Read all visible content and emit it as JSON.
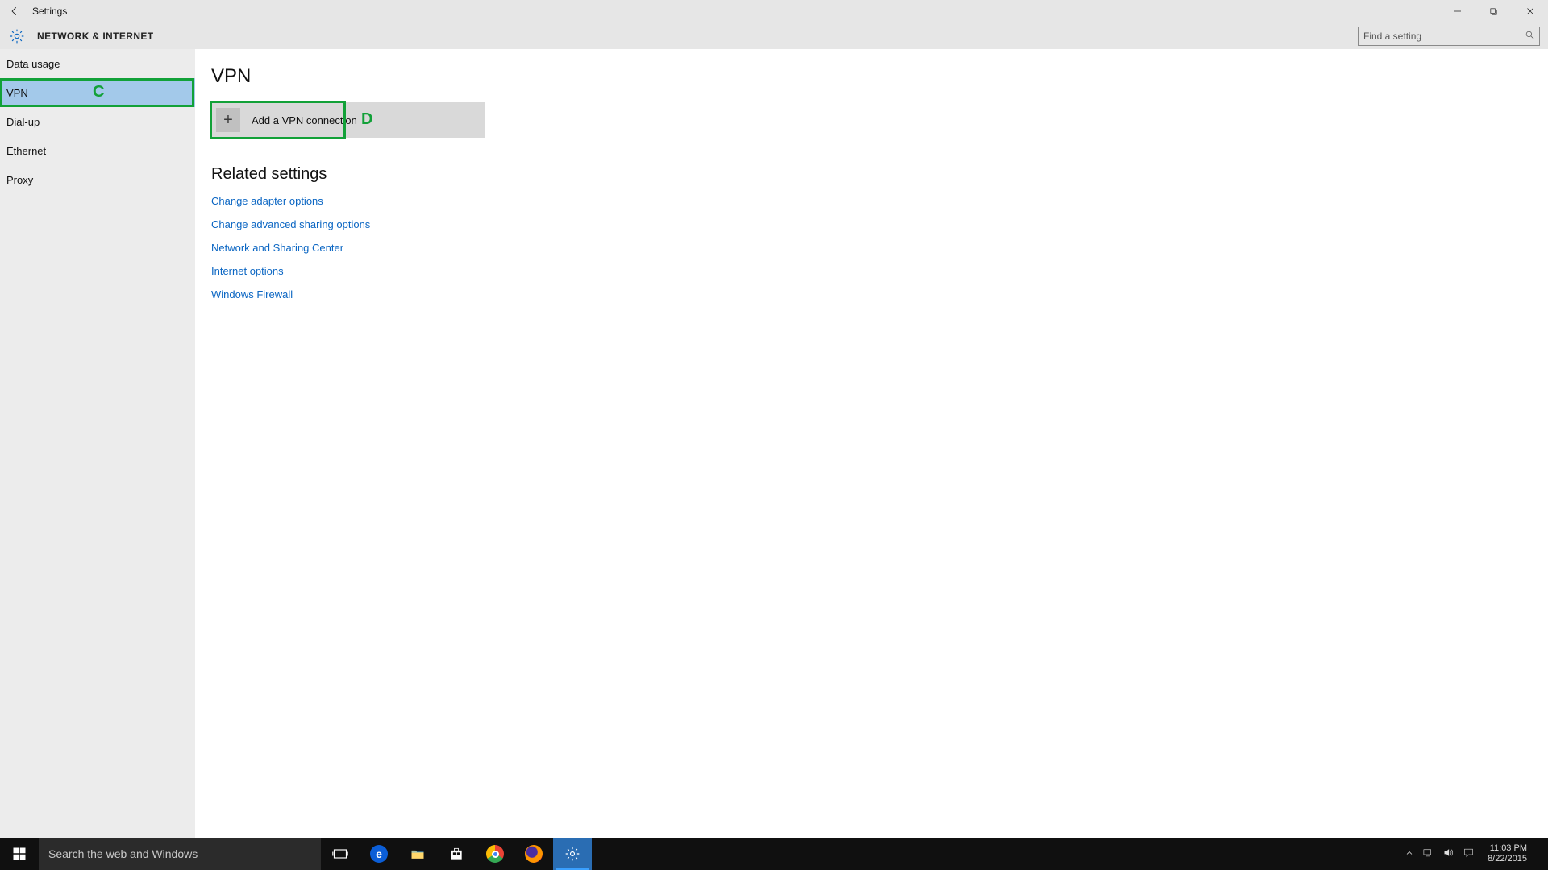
{
  "titlebar": {
    "title": "Settings"
  },
  "header": {
    "category": "NETWORK & INTERNET",
    "search_placeholder": "Find a setting"
  },
  "sidebar": {
    "items": [
      {
        "label": "Data usage",
        "selected": false
      },
      {
        "label": "VPN",
        "selected": true
      },
      {
        "label": "Dial-up",
        "selected": false
      },
      {
        "label": "Ethernet",
        "selected": false
      },
      {
        "label": "Proxy",
        "selected": false
      }
    ]
  },
  "main": {
    "page_title": "VPN",
    "add_vpn_label": "Add a VPN connection",
    "related_heading": "Related settings",
    "related_links": [
      "Change adapter options",
      "Change advanced sharing options",
      "Network and Sharing Center",
      "Internet options",
      "Windows Firewall"
    ]
  },
  "annotations": {
    "sidebar_letter": "C",
    "tile_letter": "D"
  },
  "taskbar": {
    "search_placeholder": "Search the web and Windows",
    "clock_time": "11:03 PM",
    "clock_date": "8/22/2015"
  }
}
